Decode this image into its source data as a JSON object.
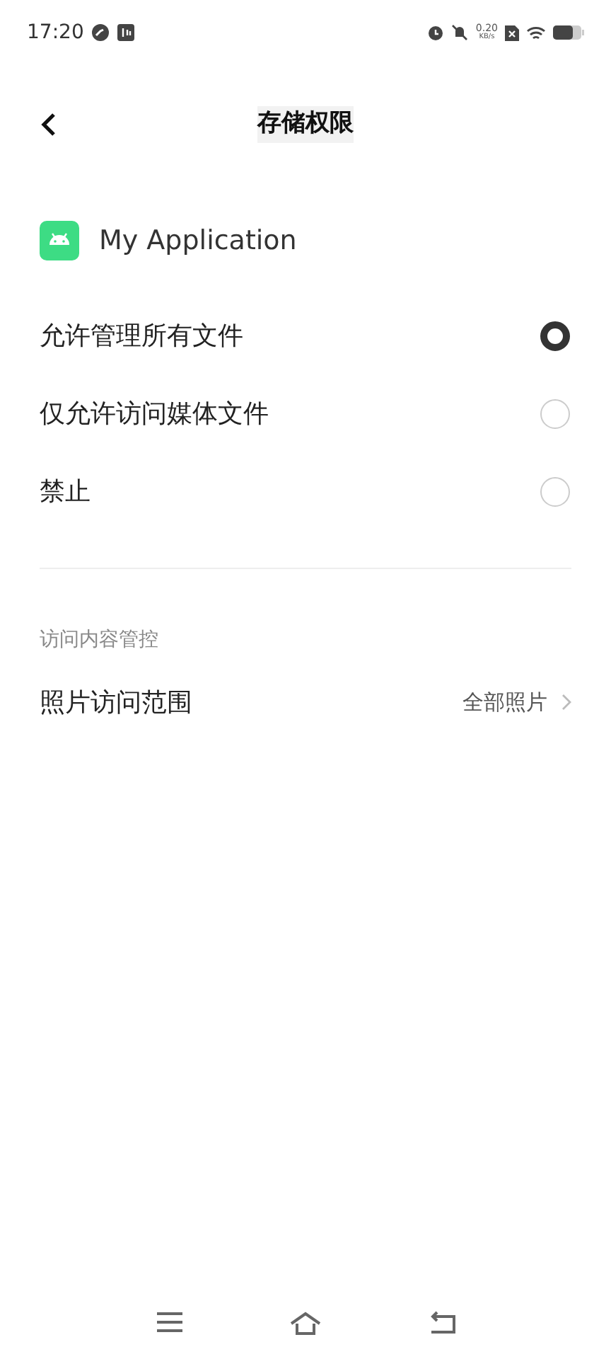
{
  "status_bar": {
    "time": "17:20",
    "speed_value": "0.20",
    "speed_unit": "KB/s"
  },
  "header": {
    "title": "存储权限"
  },
  "app": {
    "name": "My Application"
  },
  "options": [
    {
      "label": "允许管理所有文件",
      "selected": true
    },
    {
      "label": "仅允许访问媒体文件",
      "selected": false
    },
    {
      "label": "禁止",
      "selected": false
    }
  ],
  "section": {
    "title": "访问内容管控",
    "rows": [
      {
        "label": "照片访问范围",
        "value": "全部照片"
      }
    ]
  }
}
